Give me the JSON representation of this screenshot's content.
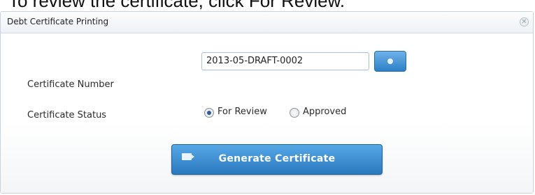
{
  "caption": "To review the certificate, click For Review.",
  "dialog": {
    "title": "Debt Certificate Printing",
    "close_icon": "close-icon"
  },
  "form": {
    "certificate_number_label": "Certificate Number",
    "certificate_number_value": "2013-05-DRAFT-0002",
    "certificate_status_label": "Certificate Status",
    "status_options": [
      {
        "label": "For Review",
        "checked": true
      },
      {
        "label": "Approved",
        "checked": false
      }
    ],
    "search_icon": "search-icon"
  },
  "actions": {
    "generate_label": "Generate Certificate",
    "generate_icon": "certificate-icon"
  },
  "colors": {
    "accent": "#2c7fc7",
    "dialog_border": "#c8d3de"
  }
}
